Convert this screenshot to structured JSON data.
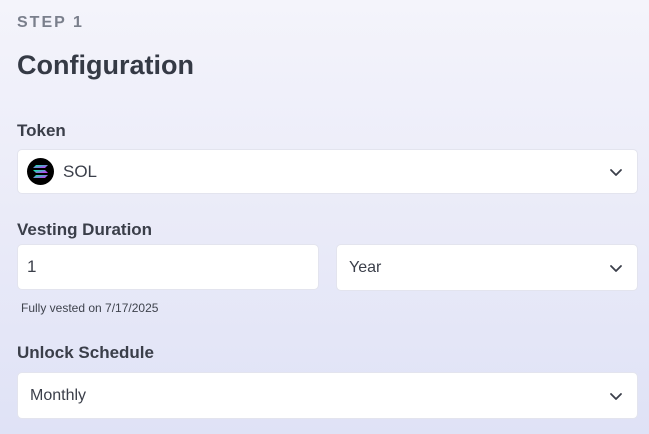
{
  "step": {
    "label": "STEP 1"
  },
  "page": {
    "title": "Configuration"
  },
  "token": {
    "label": "Token",
    "selected": "SOL",
    "icon": "solana-logo-icon"
  },
  "vesting": {
    "label": "Vesting Duration",
    "duration_value": "1",
    "unit_selected": "Year",
    "helper_text": "Fully vested on 7/17/2025"
  },
  "unlock": {
    "label": "Unlock Schedule",
    "selected": "Monthly"
  },
  "colors": {
    "page_bg_top": "#f4f4fb",
    "page_bg_bottom": "#dfe2f6",
    "text": "#3b3f4a",
    "muted": "#7a7f8c"
  }
}
